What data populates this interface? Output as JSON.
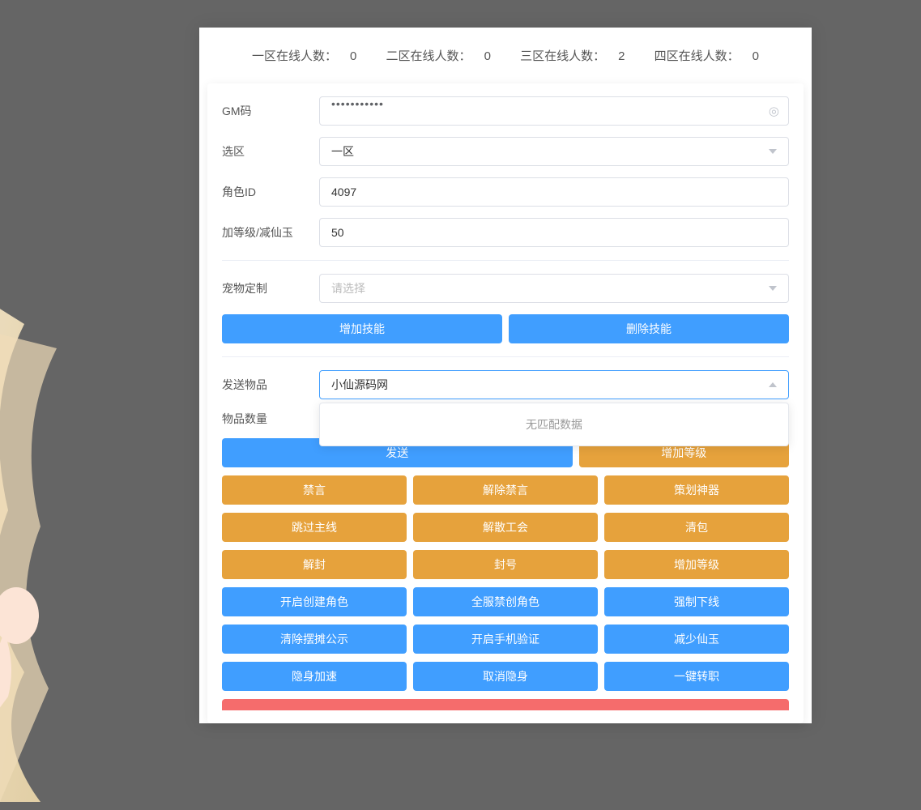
{
  "stats": {
    "zone1_label": "一区在线人数：",
    "zone1_value": "0",
    "zone2_label": "二区在线人数：",
    "zone2_value": "0",
    "zone3_label": "三区在线人数：",
    "zone3_value": "2",
    "zone4_label": "四区在线人数：",
    "zone4_value": "0"
  },
  "form": {
    "gm_code_label": "GM码",
    "gm_code_value": "•••••••••••",
    "zone_label": "选区",
    "zone_value": "一区",
    "role_id_label": "角色ID",
    "role_id_value": "4097",
    "level_label": "加等级/减仙玉",
    "level_value": "50",
    "pet_label": "宠物定制",
    "pet_placeholder": "请选择",
    "skill_add_btn": "增加技能",
    "skill_del_btn": "删除技能",
    "send_item_label": "发送物品",
    "send_item_value": "小仙源码网",
    "item_qty_label": "物品数量",
    "no_match": "无匹配数据",
    "send_btn": "发送",
    "add_level_btn": "增加等级"
  },
  "action_rows": [
    [
      {
        "label": "禁言",
        "color": "orange"
      },
      {
        "label": "解除禁言",
        "color": "orange"
      },
      {
        "label": "策划神器",
        "color": "orange"
      }
    ],
    [
      {
        "label": "跳过主线",
        "color": "orange"
      },
      {
        "label": "解散工会",
        "color": "orange"
      },
      {
        "label": "清包",
        "color": "orange"
      }
    ],
    [
      {
        "label": "解封",
        "color": "orange"
      },
      {
        "label": "封号",
        "color": "orange"
      },
      {
        "label": "增加等级",
        "color": "orange"
      }
    ],
    [
      {
        "label": "开启创建角色",
        "color": "blue"
      },
      {
        "label": "全服禁创角色",
        "color": "blue"
      },
      {
        "label": "强制下线",
        "color": "blue"
      }
    ],
    [
      {
        "label": "清除摆摊公示",
        "color": "blue"
      },
      {
        "label": "开启手机验证",
        "color": "blue"
      },
      {
        "label": "减少仙玉",
        "color": "blue"
      }
    ],
    [
      {
        "label": "隐身加速",
        "color": "blue"
      },
      {
        "label": "取消隐身",
        "color": "blue"
      },
      {
        "label": "一键转职",
        "color": "blue"
      }
    ]
  ]
}
